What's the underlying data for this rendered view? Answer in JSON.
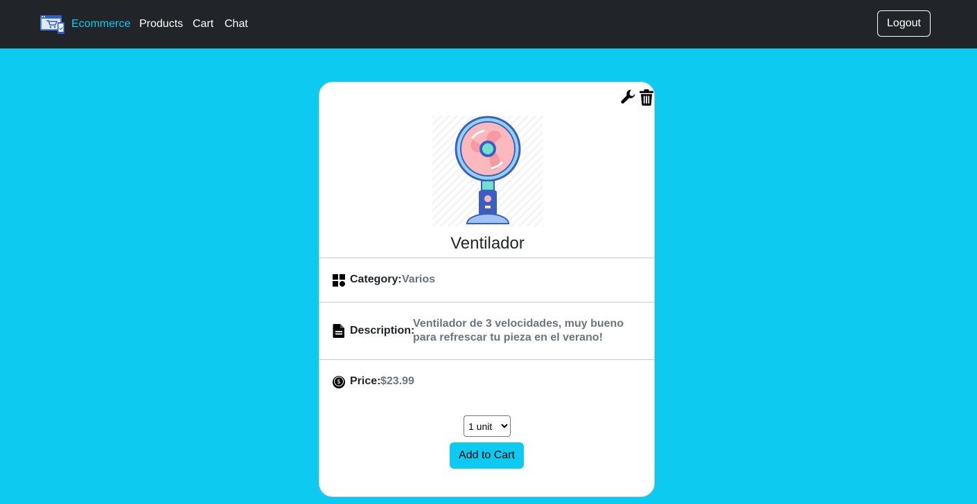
{
  "navbar": {
    "brand": "Ecommerce",
    "links": [
      "Products",
      "Cart",
      "Chat"
    ],
    "logout_label": "Logout"
  },
  "product": {
    "title": "Ventilador",
    "category_label": "Category:",
    "category_value": "Varios",
    "description_label": "Description:",
    "description_value": "Ventilador de 3 velocidades, muy bueno para refrescar tu pieza en el verano!",
    "price_label": "Price:",
    "price_value": "$23.99",
    "quantity_selected": "1 unit",
    "add_to_cart_label": "Add to Cart"
  },
  "icons": {
    "edit": "wrench-icon",
    "delete": "trash-icon",
    "category": "grid-icon",
    "description": "document-icon",
    "price": "coin-icon"
  },
  "colors": {
    "page_background": "#0dcaf0",
    "navbar_background": "#212529",
    "brand": "#0dcaf0",
    "muted_text": "#6c757d"
  }
}
